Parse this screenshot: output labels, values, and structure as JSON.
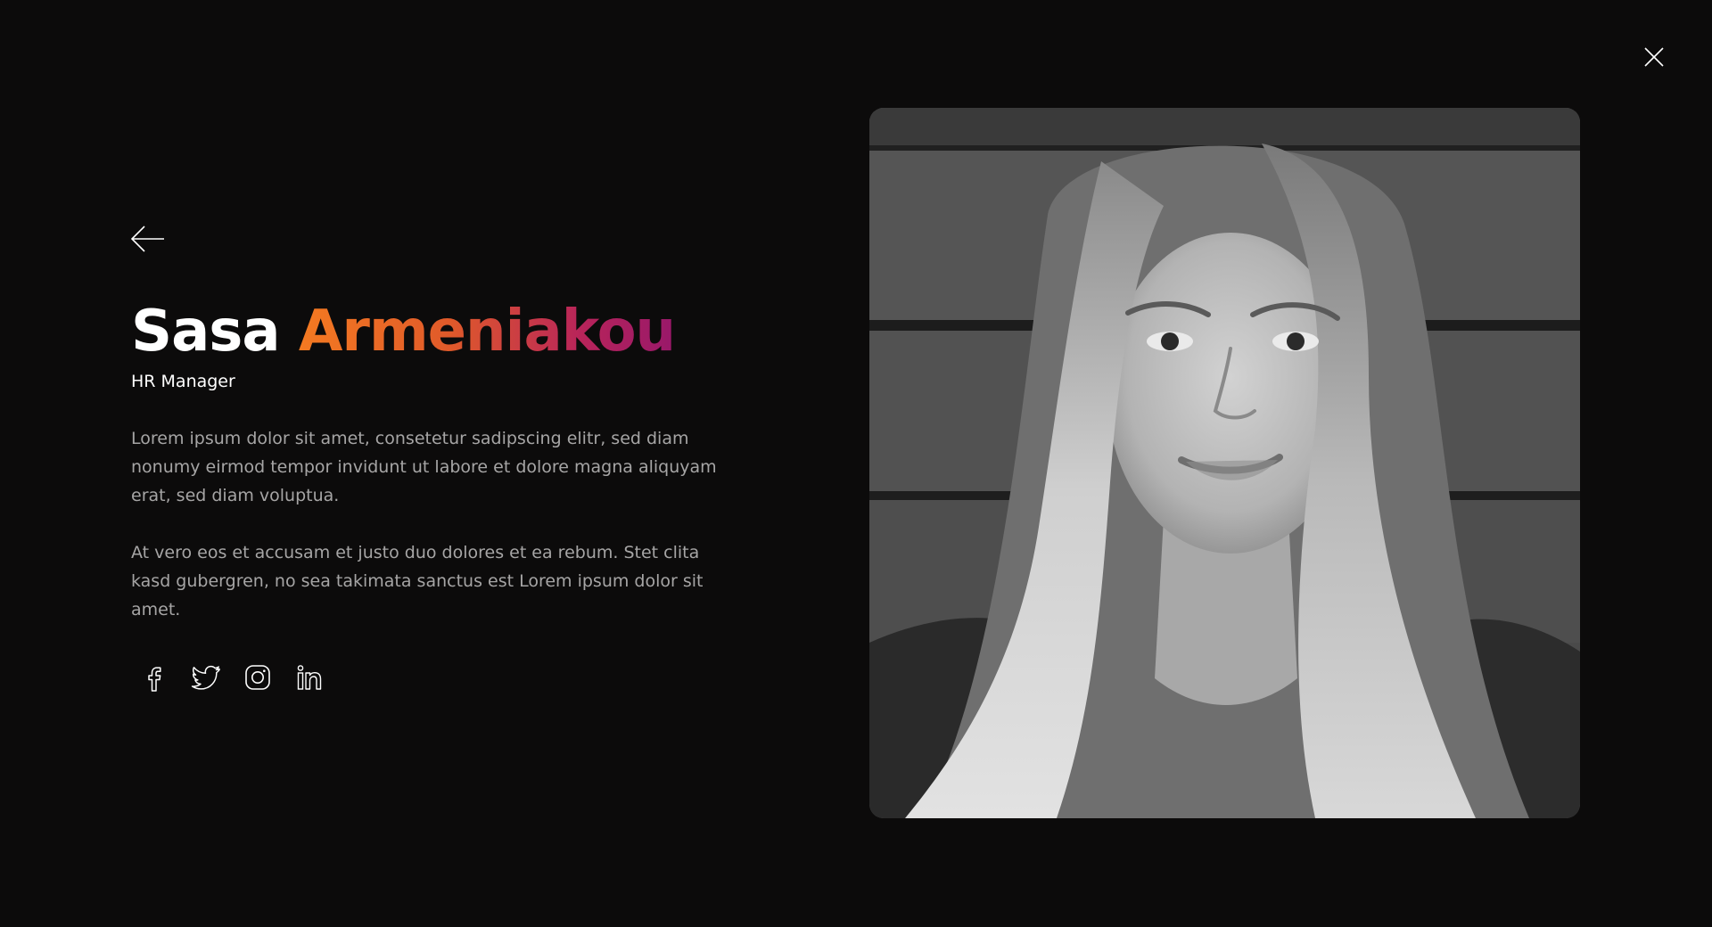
{
  "profile": {
    "first_name": "Sasa",
    "last_name": "Armeniakou",
    "role": "HR Manager",
    "bio": [
      "Lorem ipsum dolor sit amet, consetetur sadipscing elitr, sed diam nonumy eirmod tempor invidunt ut labore et dolore magna aliquyam erat, sed diam voluptua.",
      "At vero eos et accusam et justo duo dolores et ea rebum. Stet clita kasd gubergren, no sea takimata sanctus est Lorem ipsum dolor sit amet."
    ]
  },
  "nav": {
    "back_icon": "arrow-left-icon",
    "close_icon": "close-icon"
  },
  "socials": [
    "facebook-icon",
    "twitter-icon",
    "instagram-icon",
    "linkedin-icon"
  ],
  "colors": {
    "background": "#0c0b0b",
    "text": "#ffffff",
    "body_text": "#a6a5a5",
    "gradient_start": "#f47a21",
    "gradient_end": "#98186a"
  }
}
